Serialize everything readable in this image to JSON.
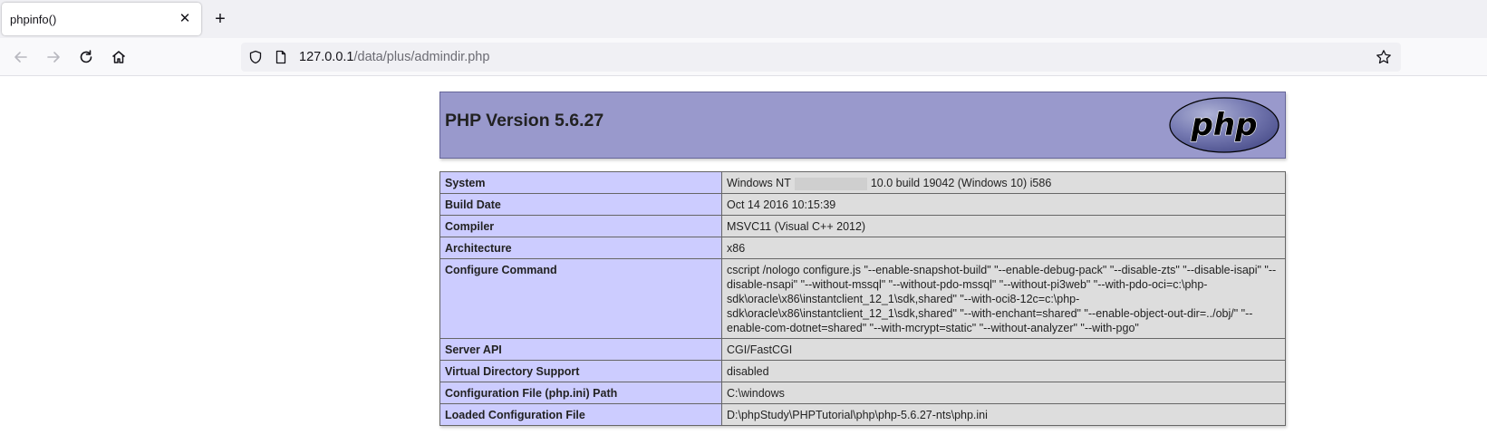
{
  "tab": {
    "title": "phpinfo()"
  },
  "urlbar": {
    "host": "127.0.0.1",
    "path": "/data/plus/admindir.php"
  },
  "icons": {
    "back": "arrow-left-icon",
    "forward": "arrow-right-icon",
    "reload": "reload-icon",
    "home": "home-icon",
    "shield": "shield-icon",
    "page": "page-icon",
    "star": "star-icon",
    "close": "close-icon",
    "newtab": "plus-icon"
  },
  "colors": {
    "header_bg": "#9999cc",
    "key_bg": "#ccccff",
    "value_bg": "#dddddd"
  },
  "php": {
    "title": "PHP Version 5.6.27",
    "logo_text": "php",
    "rows": [
      {
        "key": "System",
        "value_pre": "Windows NT",
        "value_post": "10.0 build 19042 (Windows 10) i586"
      },
      {
        "key": "Build Date",
        "value": "Oct 14 2016 10:15:39"
      },
      {
        "key": "Compiler",
        "value": "MSVC11 (Visual C++ 2012)"
      },
      {
        "key": "Architecture",
        "value": "x86"
      },
      {
        "key": "Configure Command",
        "value": "cscript /nologo configure.js \"--enable-snapshot-build\" \"--enable-debug-pack\" \"--disable-zts\" \"--disable-isapi\" \"--disable-nsapi\" \"--without-mssql\" \"--without-pdo-mssql\" \"--without-pi3web\" \"--with-pdo-oci=c:\\php-sdk\\oracle\\x86\\instantclient_12_1\\sdk,shared\" \"--with-oci8-12c=c:\\php-sdk\\oracle\\x86\\instantclient_12_1\\sdk,shared\" \"--with-enchant=shared\" \"--enable-object-out-dir=../obj/\" \"--enable-com-dotnet=shared\" \"--with-mcrypt=static\" \"--without-analyzer\" \"--with-pgo\""
      },
      {
        "key": "Server API",
        "value": "CGI/FastCGI"
      },
      {
        "key": "Virtual Directory Support",
        "value": "disabled"
      },
      {
        "key": "Configuration File (php.ini) Path",
        "value": "C:\\windows"
      },
      {
        "key": "Loaded Configuration File",
        "value": "D:\\phpStudy\\PHPTutorial\\php\\php-5.6.27-nts\\php.ini"
      }
    ]
  }
}
